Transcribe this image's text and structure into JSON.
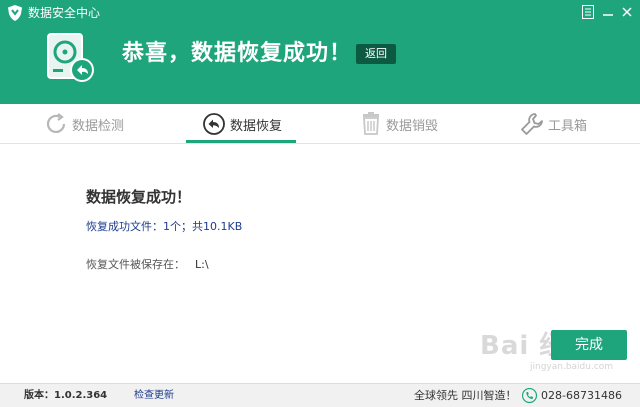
{
  "window": {
    "title": "数据安全中心",
    "accent_color": "#1fa57c"
  },
  "hero": {
    "title": "恭喜，数据恢复成功！",
    "back_label": "返回",
    "icon": "disk-recover-icon"
  },
  "tabs": [
    {
      "label": "数据检测",
      "icon": "refresh-icon"
    },
    {
      "label": "数据恢复",
      "icon": "undo-icon",
      "active": true
    },
    {
      "label": "数据销毁",
      "icon": "trash-icon"
    },
    {
      "label": "工具箱",
      "icon": "wrench-icon"
    }
  ],
  "content": {
    "title": "数据恢复成功！",
    "result": "恢复成功文件：1个；共10.1KB",
    "path_label": "恢复文件被保存在：",
    "path_value": "L:\\"
  },
  "finish_label": "完成",
  "watermark": {
    "text": "Bai 经验",
    "sub": "jingyan.baidu.com"
  },
  "status": {
    "version": "版本：1.0.2.364",
    "update_link": "检查更新",
    "slogan": "全球领先 四川智造！",
    "phone": "028-68731486"
  }
}
